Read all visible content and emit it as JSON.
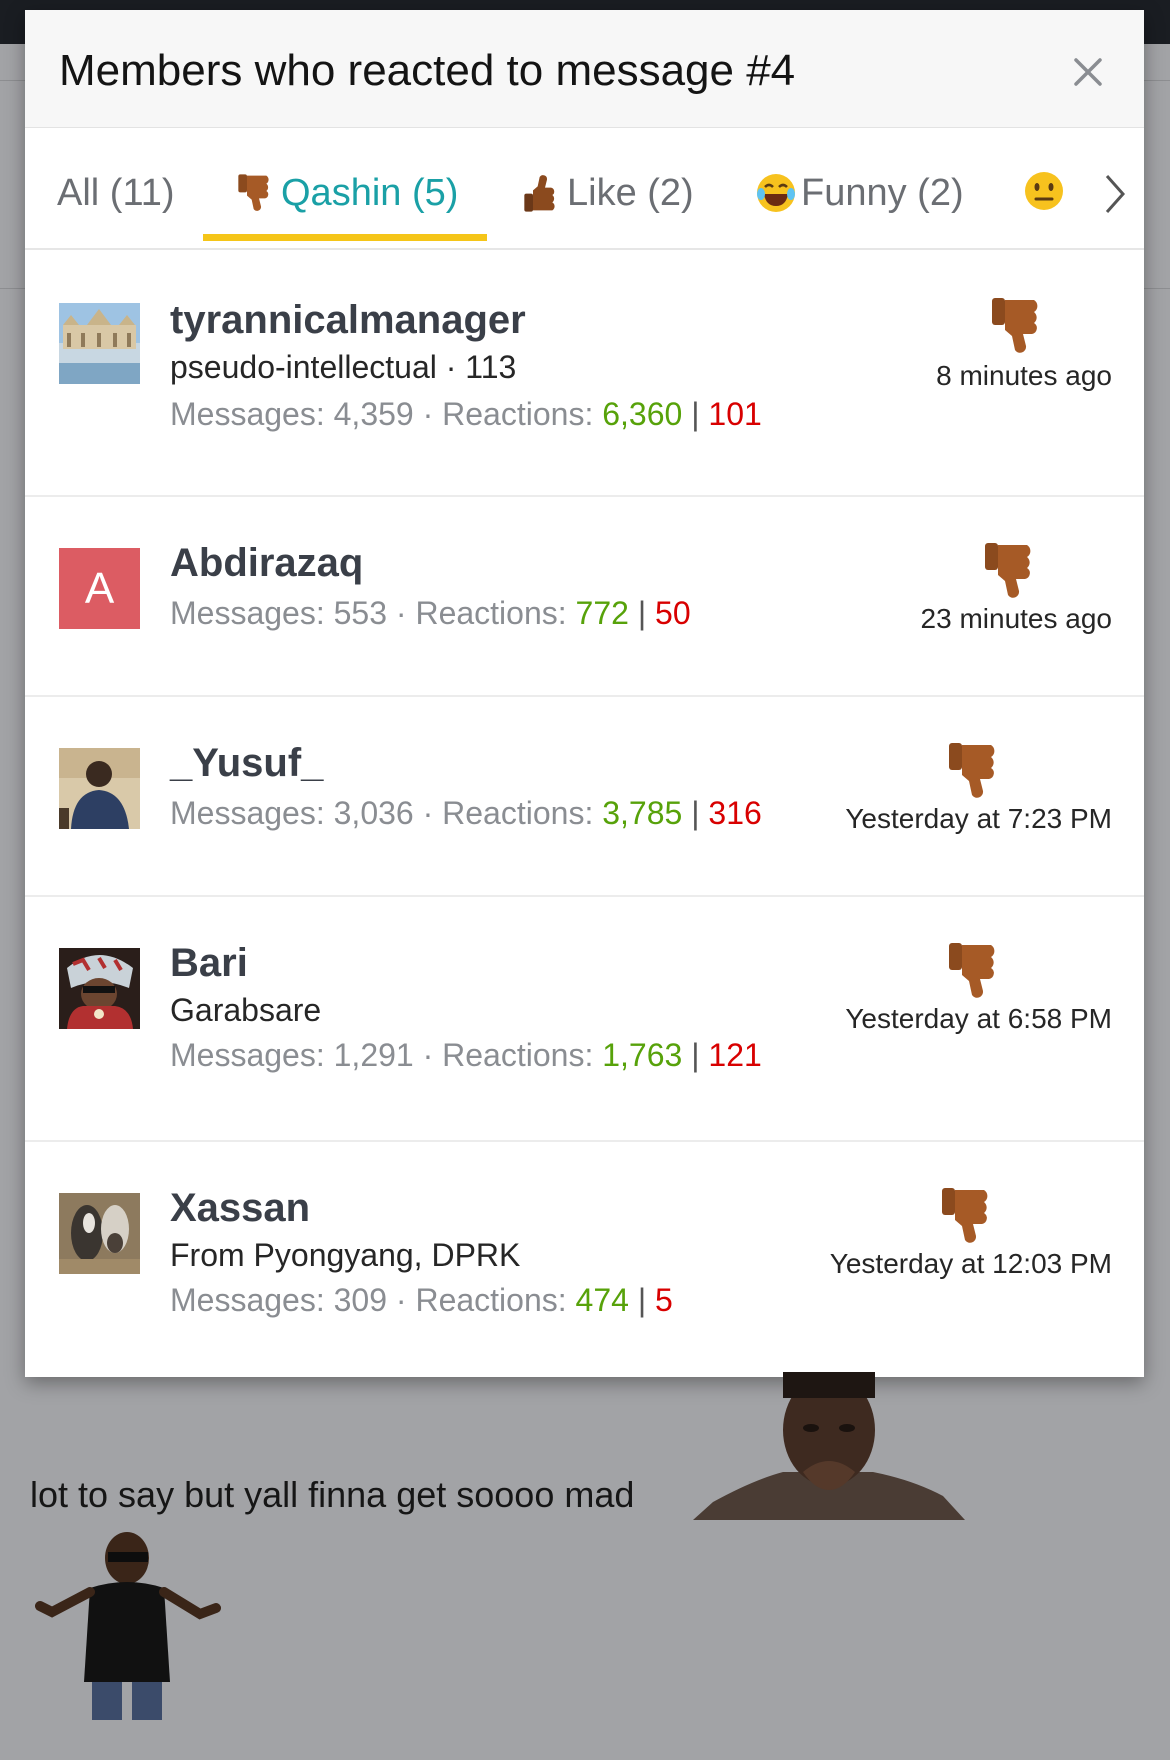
{
  "modal": {
    "title": "Members who reacted to message #4"
  },
  "tabs": [
    {
      "label": "All (11)",
      "icon": "none"
    },
    {
      "label": "Qashin (5)",
      "icon": "thumbs-down-icon",
      "active": true
    },
    {
      "label": "Like (2)",
      "icon": "thumbs-up-icon"
    },
    {
      "label": "Funny (2)",
      "icon": "laughing-face-icon"
    }
  ],
  "rows": [
    {
      "username": "tyrannicalmanager",
      "subtitle": "pseudo-intellectual · 113",
      "messages_label": "Messages:",
      "messages": "4,359",
      "reactions_label": "Reactions:",
      "reactions_pos": "6,360",
      "reactions_neg": "101",
      "time": "8 minutes ago",
      "avatar": "mosque-photo-avatar"
    },
    {
      "username": "Abdirazaq",
      "subtitle": "",
      "messages_label": "Messages:",
      "messages": "553",
      "reactions_label": "Reactions:",
      "reactions_pos": "772",
      "reactions_neg": "50",
      "time": "23 minutes ago",
      "avatar_letter": "A"
    },
    {
      "username": "_Yusuf_",
      "subtitle": "",
      "messages_label": "Messages:",
      "messages": "3,036",
      "reactions_label": "Reactions:",
      "reactions_pos": "3,785",
      "reactions_neg": "316",
      "time": "Yesterday at 7:23 PM",
      "avatar": "person-photo-avatar"
    },
    {
      "username": "Bari",
      "subtitle": "Garabsare",
      "messages_label": "Messages:",
      "messages": "1,291",
      "reactions_label": "Reactions:",
      "reactions_pos": "1,763",
      "reactions_neg": "121",
      "time": "Yesterday at 6:58 PM",
      "avatar": "smoking-man-avatar"
    },
    {
      "username": "Xassan",
      "subtitle": "From Pyongyang, DPRK",
      "messages_label": "Messages:",
      "messages": "309",
      "reactions_label": "Reactions:",
      "reactions_pos": "474",
      "reactions_neg": "5",
      "time": "Yesterday at 12:03 PM",
      "avatar": "animals-photo-avatar"
    }
  ],
  "post": {
    "text": "lot to say but yall finna get soooo mad"
  },
  "colors": {
    "accent": "#1aa0a6",
    "tab_underline": "#f5c518",
    "positive": "#57a20a",
    "negative": "#d80000",
    "avatar_letter_bg": "#dc5c63"
  }
}
